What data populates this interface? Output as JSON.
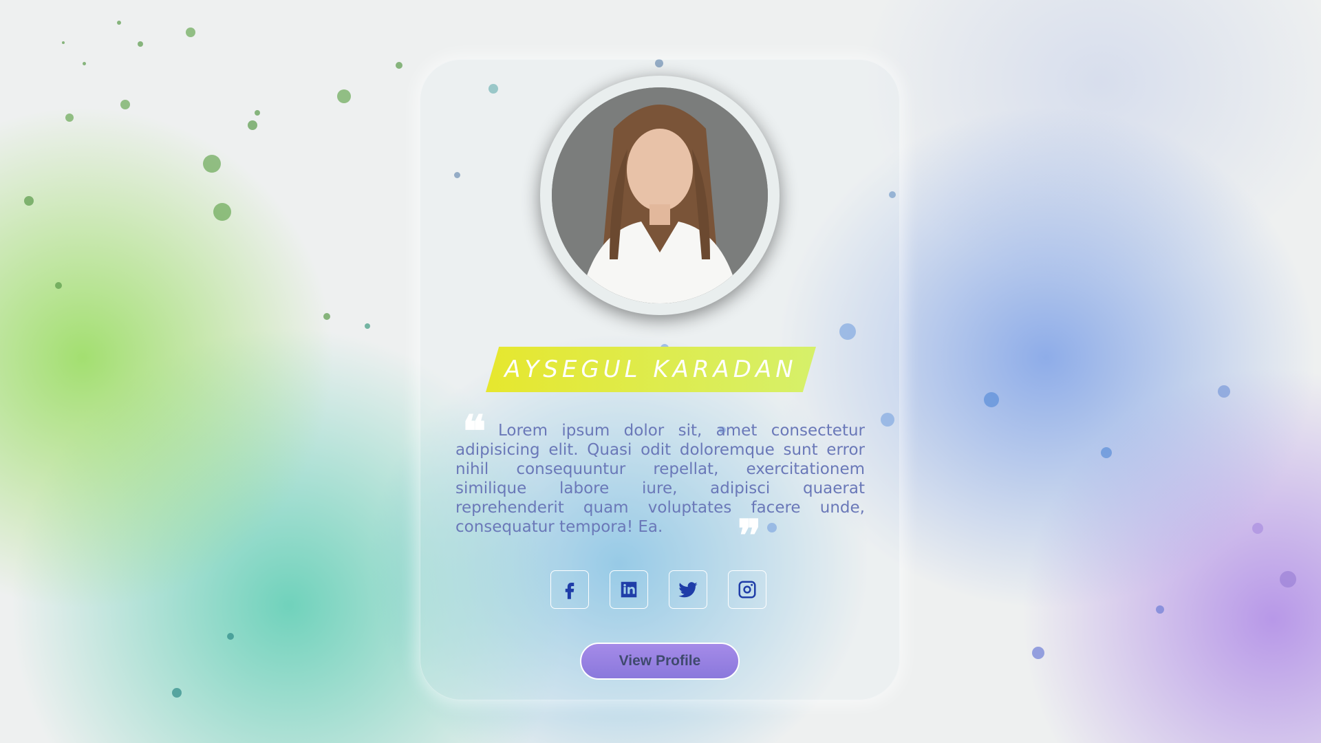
{
  "profile": {
    "name": "AYSEGUL KARADAN",
    "bio": "Lorem ipsum dolor sit, amet consectetur adipisicing elit. Quasi odit doloremque sunt error nihil consequuntur repellat, exercitationem similique labore iure, adipisci quaerat reprehenderit quam voluptates facere unde, consequatur tempora! Ea.",
    "photo_icon": "portrait-photo",
    "quote_open": "❝",
    "quote_close": "❞"
  },
  "socials": [
    {
      "icon": "facebook-icon"
    },
    {
      "icon": "linkedin-icon"
    },
    {
      "icon": "twitter-icon"
    },
    {
      "icon": "instagram-icon"
    }
  ],
  "actions": {
    "view_profile_label": "View Profile"
  },
  "colors": {
    "name_banner": "#e6e72e",
    "bio_text": "#6a78b8",
    "social_icon": "#1f3da8",
    "button": "#a58be8"
  }
}
